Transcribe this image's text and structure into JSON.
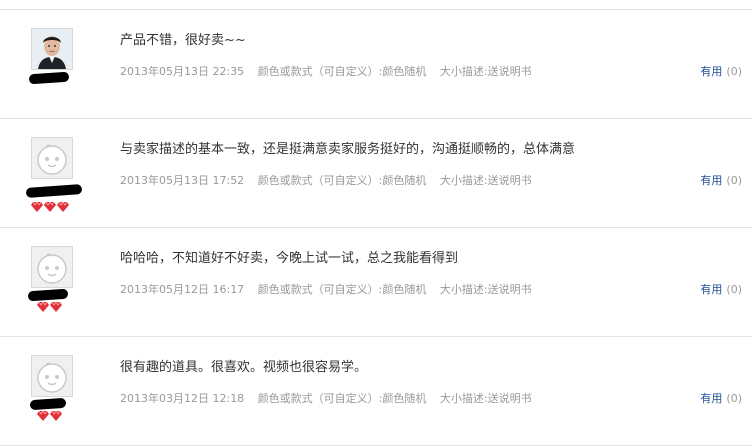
{
  "reviews": [
    {
      "content": "产品不错，很好卖~~",
      "date": "2013年05月13日 22:35",
      "color_option": "颜色或款式（可自定义）:颜色随机",
      "size_option": "大小描述:送说明书",
      "useful_label": "有用",
      "useful_count": "(0)",
      "avatar": "photo",
      "gems": 0
    },
    {
      "content": "与卖家描述的基本一致，还是挺满意卖家服务挺好的，沟通挺顺畅的，总体满意",
      "date": "2013年05月13日 17:52",
      "color_option": "颜色或款式（可自定义）:颜色随机",
      "size_option": "大小描述:送说明书",
      "useful_label": "有用",
      "useful_count": "(0)",
      "avatar": "default",
      "gems": 3
    },
    {
      "content": "哈哈哈，不知道好不好卖，今晚上试一试，总之我能看得到",
      "date": "2013年05月12日 16:17",
      "color_option": "颜色或款式（可自定义）:颜色随机",
      "size_option": "大小描述:送说明书",
      "useful_label": "有用",
      "useful_count": "(0)",
      "avatar": "default",
      "gems": 2
    },
    {
      "content": "很有趣的道具。很喜欢。视频也很容易学。",
      "date": "2013年03月12日 12:18",
      "color_option": "颜色或款式（可自定义）:颜色随机",
      "size_option": "大小描述:送说明书",
      "useful_label": "有用",
      "useful_count": "(0)",
      "avatar": "default",
      "gems": 2
    }
  ],
  "colors": {
    "link": "#1f4e99",
    "meta": "#999999",
    "gem": "#e0313b"
  }
}
